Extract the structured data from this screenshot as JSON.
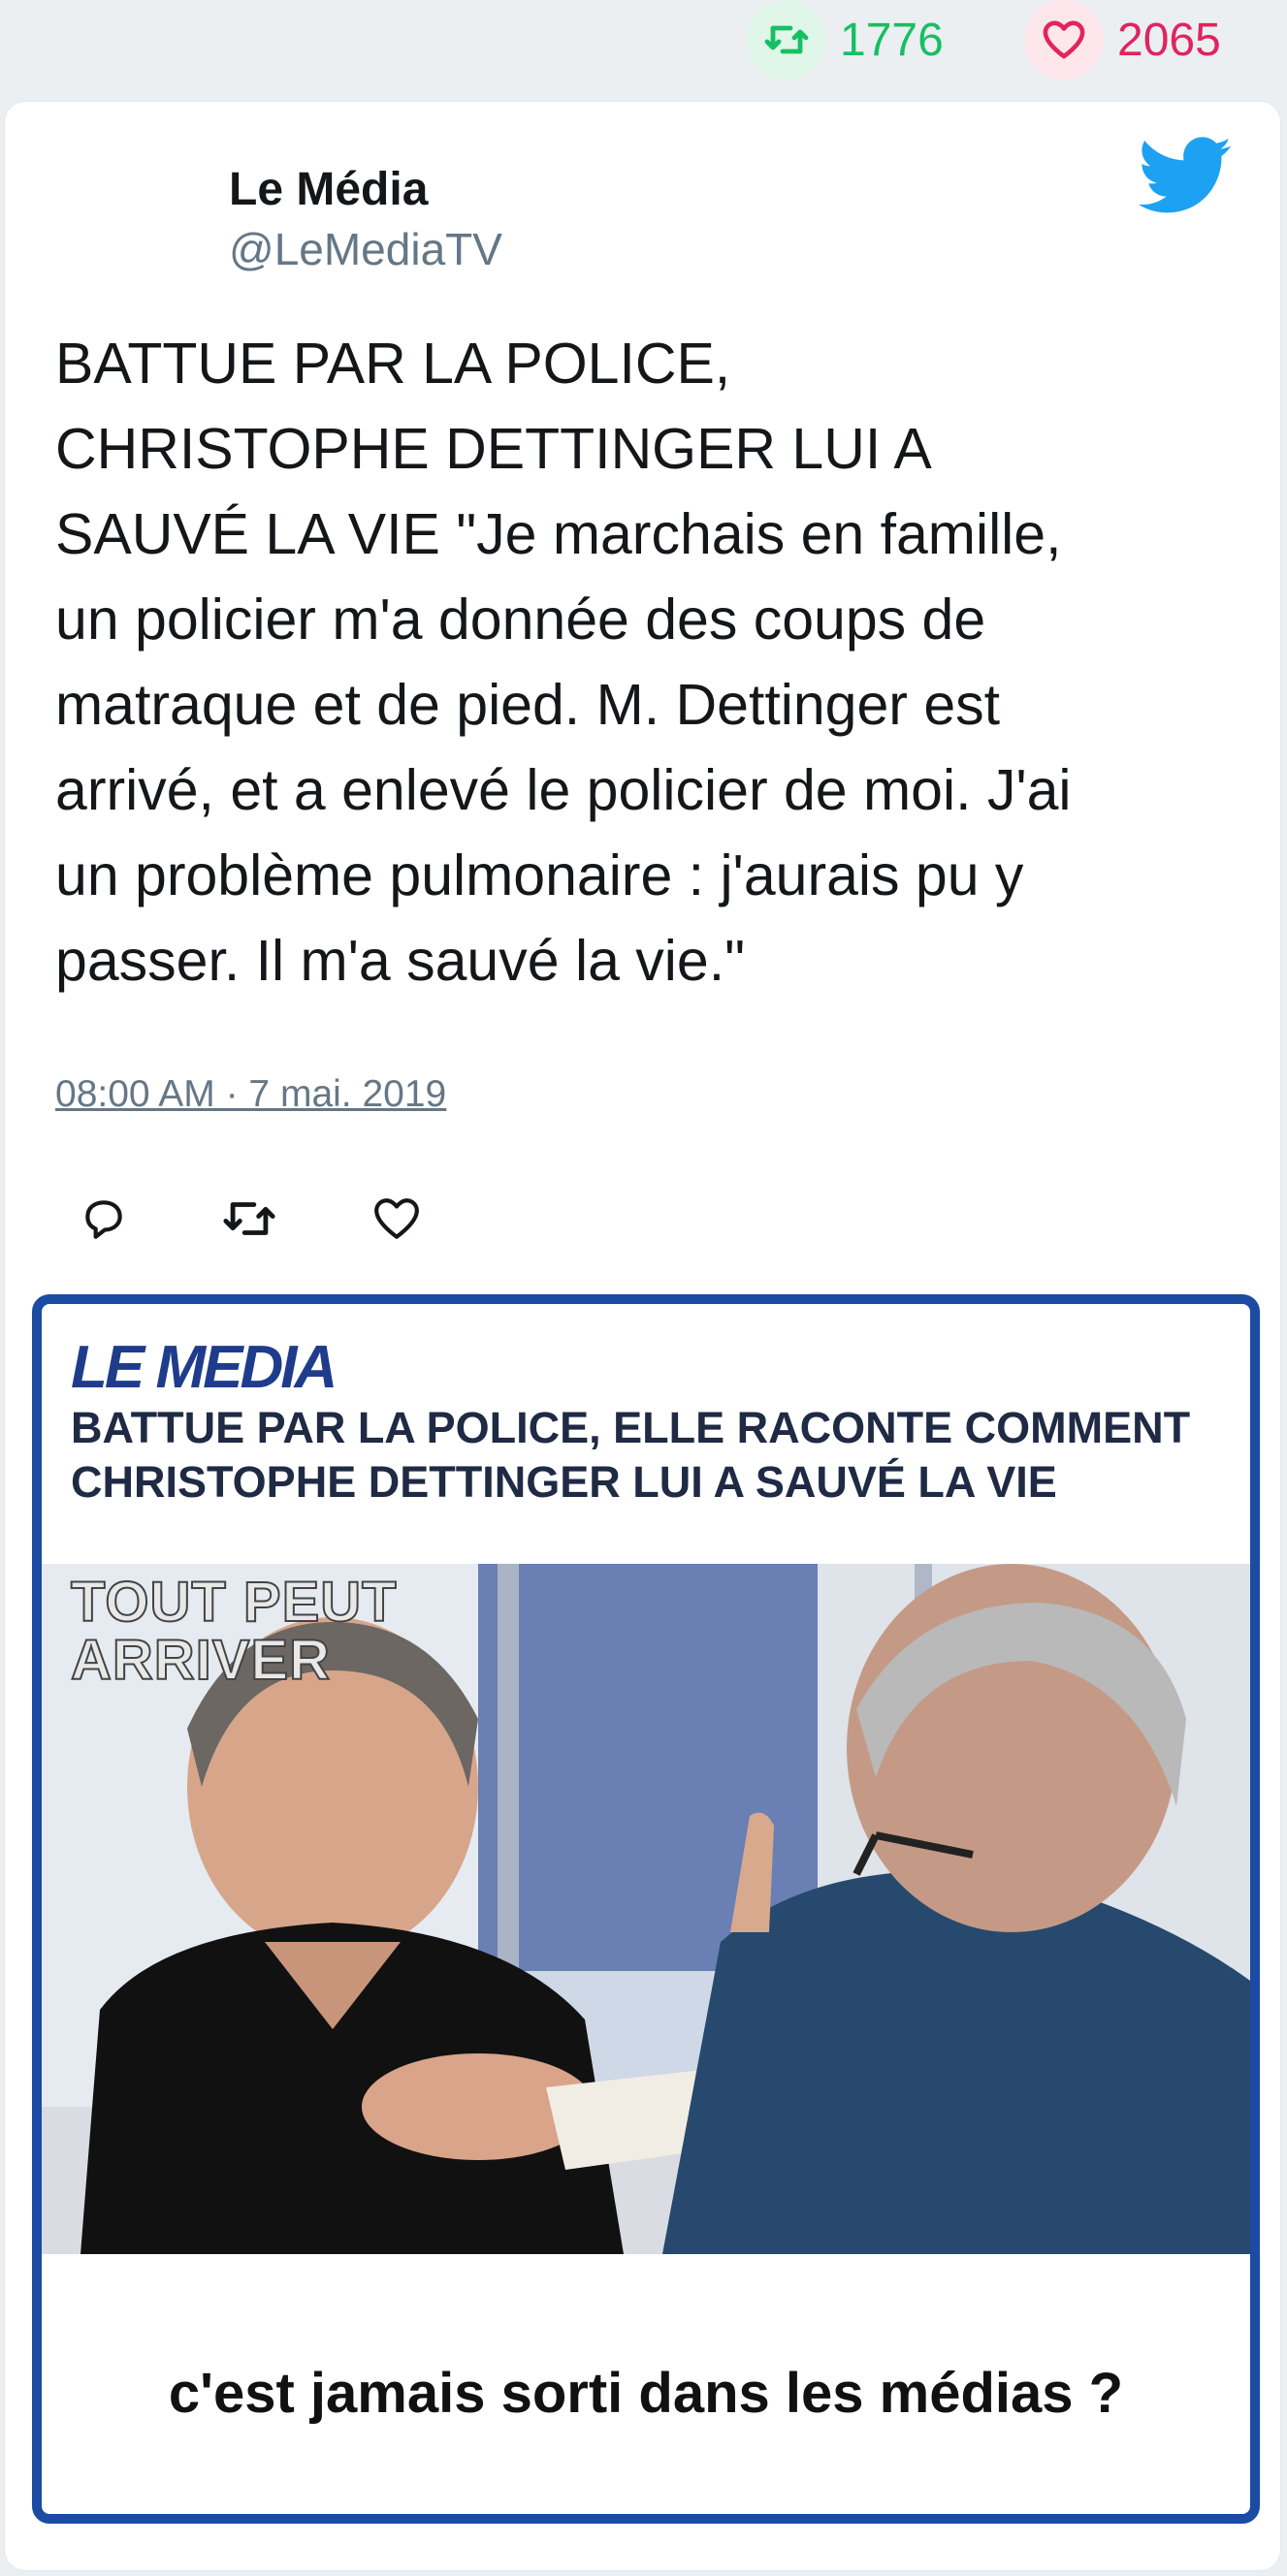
{
  "stats": {
    "retweets": "1776",
    "likes": "2065"
  },
  "tweet": {
    "author_name": "Le Média",
    "author_handle": "@LeMediaTV",
    "text": "BATTUE PAR LA POLICE,\nCHRISTOPHE DETTINGER LUI A\nSAUVÉ LA VIE \"Je marchais en famille,\nun policier m'a donnée des coups de\nmatraque et de pied. M. Dettinger est\narrivé, et a enlevé le policier de moi. J'ai\nun problème pulmonaire : j'aurais pu y\npasser. Il m'a sauvé la vie.\"",
    "timestamp": "08:00 AM · 7 mai. 2019"
  },
  "media": {
    "logo": "LE MEDIA",
    "headline": "BATTUE PAR LA POLICE, ELLE RACONTE COMMENT\nCHRISTOPHE DETTINGER LUI A SAUVÉ LA VIE",
    "overlay_title": "TOUT PEUT\nARRIVER",
    "caption": "c'est jamais sorti dans les médias ?"
  },
  "colors": {
    "retweet_green": "#17bf63",
    "like_red": "#e0245e",
    "twitter_blue": "#1da1f2",
    "frame_blue": "#1b4ba2"
  },
  "icons": [
    "retweet-icon",
    "heart-icon",
    "twitter-bird-icon",
    "reply-icon"
  ]
}
